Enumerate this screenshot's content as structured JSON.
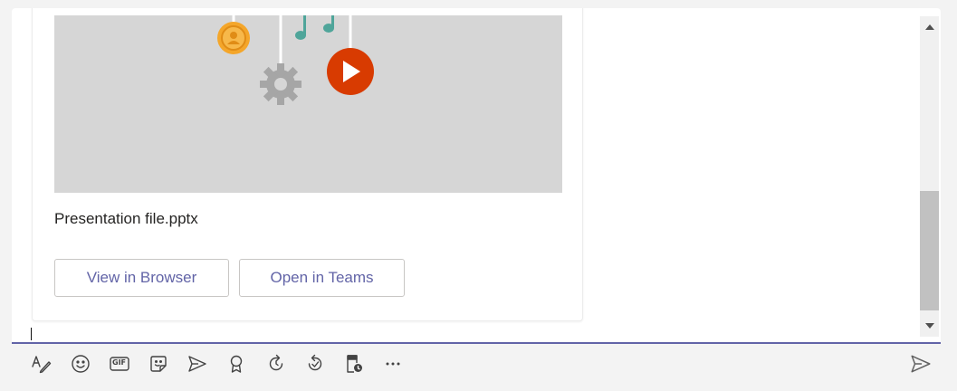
{
  "card": {
    "file_name": "Presentation file.pptx",
    "view_button_label": "View in Browser",
    "open_button_label": "Open in Teams"
  },
  "toolbar": {
    "gif_label": "GIF",
    "tools": [
      "format-icon",
      "emoji-icon",
      "gif-icon",
      "sticker-icon",
      "schedule-meeting-icon",
      "praise-icon",
      "loop-icon",
      "updates-icon",
      "approvals-icon",
      "more-options-icon"
    ],
    "send": "send-icon"
  },
  "colors": {
    "accent": "#6264a7",
    "play_button": "#d83b01",
    "note": "#4fa59a",
    "coin": "#f4a62a"
  }
}
